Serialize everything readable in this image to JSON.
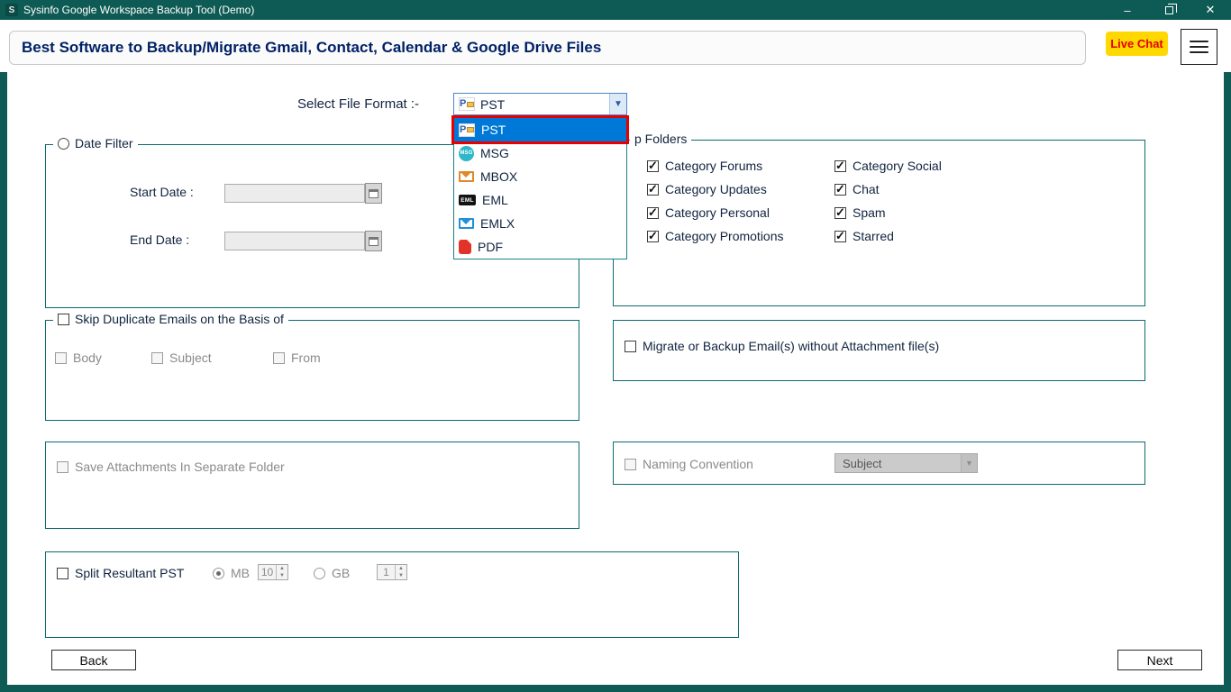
{
  "window": {
    "title": "Sysinfo Google Workspace Backup Tool (Demo)",
    "logo_text": "S",
    "minimize_icon": "–",
    "close_icon": "✕"
  },
  "header": {
    "banner": "Best Software to Backup/Migrate Gmail, Contact, Calendar & Google Drive Files",
    "live_chat_label": "Live Chat"
  },
  "colors": {
    "titlebar": "#0e5a54",
    "selection_highlight": "#0078d7",
    "selection_border": "#e60000",
    "live_chat_bg": "#ffd800",
    "live_chat_text": "#e30000",
    "banner_text": "#002166"
  },
  "file_format": {
    "label": "Select File Format :-",
    "selected_value": "PST",
    "dropdown_open": true,
    "options": [
      {
        "label": "PST",
        "icon": "pst-icon",
        "highlighted": true
      },
      {
        "label": "MSG",
        "icon": "msg-icon",
        "highlighted": false
      },
      {
        "label": "MBOX",
        "icon": "mbox-icon",
        "highlighted": false
      },
      {
        "label": "EML",
        "icon": "eml-icon",
        "highlighted": false
      },
      {
        "label": "EMLX",
        "icon": "emlx-icon",
        "highlighted": false
      },
      {
        "label": "PDF",
        "icon": "pdf-icon",
        "highlighted": false
      }
    ]
  },
  "date_filter": {
    "title": "Date Filter",
    "selected": false,
    "start_label": "Start Date :",
    "start_value": "",
    "end_label": "End Date :",
    "end_value": ""
  },
  "backup_folders": {
    "title": "p Folders",
    "column1": [
      {
        "label": "Category Forums",
        "checked": true
      },
      {
        "label": "Category Updates",
        "checked": true
      },
      {
        "label": "Category Personal",
        "checked": true
      },
      {
        "label": "Category Promotions",
        "checked": true
      }
    ],
    "column2": [
      {
        "label": "Category Social",
        "checked": true
      },
      {
        "label": "Chat",
        "checked": true
      },
      {
        "label": "Spam",
        "checked": true
      },
      {
        "label": "Starred",
        "checked": true
      }
    ]
  },
  "skip_duplicates": {
    "title": "Skip Duplicate Emails on the Basis of",
    "checked": false,
    "options": [
      {
        "label": "Body",
        "checked": false
      },
      {
        "label": "Subject",
        "checked": false
      },
      {
        "label": "From",
        "checked": false
      }
    ]
  },
  "attachments_option": {
    "label": "Migrate or Backup Email(s) without Attachment file(s)",
    "checked": false
  },
  "save_attachments": {
    "label": "Save Attachments In Separate Folder",
    "checked": false
  },
  "naming_convention": {
    "label": "Naming Convention",
    "checked": false,
    "value": "Subject"
  },
  "split": {
    "label": "Split  Resultant PST",
    "checked": false,
    "mb": {
      "label": "MB",
      "selected": true,
      "value": "10"
    },
    "gb": {
      "label": "GB",
      "selected": false,
      "value": "1"
    }
  },
  "footer": {
    "back_label": "Back",
    "next_label": "Next"
  }
}
